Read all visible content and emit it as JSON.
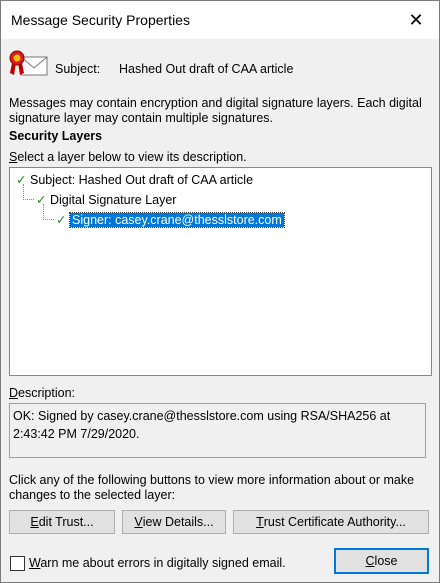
{
  "window": {
    "title": "Message Security Properties",
    "close_glyph": "✕"
  },
  "subject": {
    "label": "Subject:",
    "value": "Hashed Out draft of CAA article",
    "icon": "signed-envelope-icon"
  },
  "info_text": "Messages may contain encryption and digital signature layers. Each digital signature layer may contain multiple signatures.",
  "security_layers": {
    "heading": "Security Layers",
    "select_label": "Select a layer below to view its description.",
    "tree": [
      {
        "label": "Subject: Hashed Out draft of CAA article",
        "checked": true,
        "level": 0
      },
      {
        "label": "Digital Signature Layer",
        "checked": true,
        "level": 1
      },
      {
        "label": "Signer: casey.crane@thesslstore.com",
        "checked": true,
        "level": 2,
        "selected": true
      }
    ]
  },
  "description": {
    "label": "Description:",
    "text": "OK: Signed by casey.crane@thesslstore.com using RSA/SHA256 at 2:43:42 PM 7/29/2020."
  },
  "actions": {
    "instruction": "Click any of the following buttons to view more information about or make changes to the selected layer:",
    "edit_trust": "Edit Trust...",
    "view_details": "View Details...",
    "trust_ca": "Trust Certificate Authority..."
  },
  "footer": {
    "warn_label": "Warn me about errors in digitally signed email.",
    "warn_checked": false,
    "close_label": "Close"
  },
  "colors": {
    "accent": "#0078d7",
    "check_green": "#1b8a1b"
  }
}
